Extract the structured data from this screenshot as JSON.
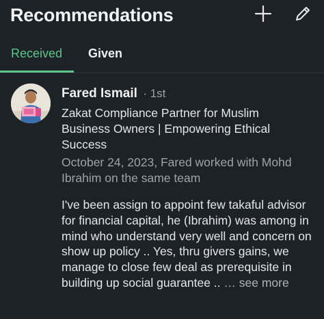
{
  "header": {
    "title": "Recommendations",
    "add_icon": "plus-icon",
    "edit_icon": "pencil-icon"
  },
  "tabs": [
    {
      "label": "Received",
      "active": true
    },
    {
      "label": "Given",
      "active": false
    }
  ],
  "colors": {
    "background": "#1d2226",
    "accent": "#5fc48c",
    "secondary_text": "#9ea3a7"
  },
  "recommendation": {
    "name": "Fared Ismail",
    "degree": "· 1st",
    "headline": "Zakat Compliance Partner for Muslim Business Owners | Empowering Ethical Success",
    "meta": "October 24, 2023, Fared worked with Mohd Ibrahim on the same team",
    "text": "I've been assign to appoint few takaful advisor for financial capital, he (Ibrahim) was among in mind who understand very well and concern on show up policy .. Yes, thru givers gains, we manage to close few deal as prerequisite in building up social guarantee .. ",
    "see_more": "… see more"
  }
}
